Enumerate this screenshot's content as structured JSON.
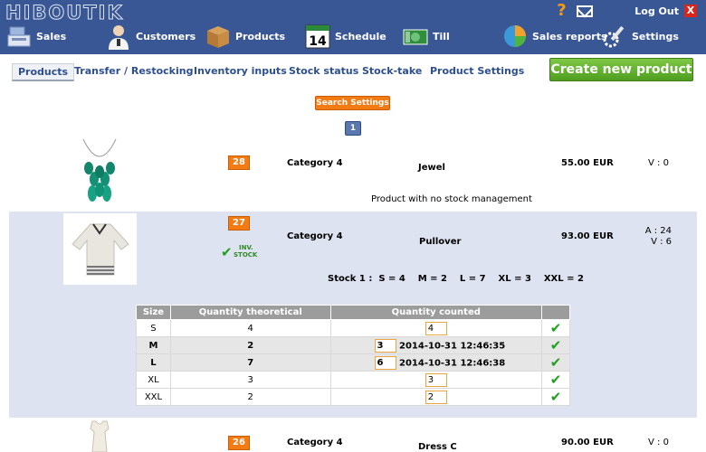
{
  "app": {
    "logo": "HIBOUTIK"
  },
  "header": {
    "nav": [
      {
        "label": "Sales",
        "icon": "register-icon"
      },
      {
        "label": "Customers",
        "icon": "person-icon"
      },
      {
        "label": "Products",
        "icon": "box-icon"
      },
      {
        "label": "Schedule",
        "icon": "calendar-icon",
        "icon_text": "14"
      },
      {
        "label": "Till",
        "icon": "banknote-icon"
      },
      {
        "label": "Sales reports",
        "icon": "pie-chart-icon"
      },
      {
        "label": "Settings",
        "icon": "wrench-gear-icon"
      }
    ],
    "help": "?",
    "logout": "Log Out",
    "close": "X"
  },
  "tabs": [
    {
      "label": "Products",
      "active": true
    },
    {
      "label": "Transfer / Restocking"
    },
    {
      "label": "Inventory inputs"
    },
    {
      "label": "Stock status"
    },
    {
      "label": "Stock-take"
    },
    {
      "label": "Product Settings"
    }
  ],
  "create_button": "Create new product",
  "search_settings": "Search Settings",
  "pagination": {
    "current": "1"
  },
  "products": [
    {
      "id": "28",
      "category": "Category 4",
      "name": "Jewel",
      "price": "55.00 EUR",
      "stock_v": "V : 0",
      "note": "Product with no stock management",
      "image": "necklace"
    },
    {
      "id": "27",
      "category": "Category 4",
      "name": "Pullover",
      "price": "93.00 EUR",
      "stock_a": "A : 24",
      "stock_v": "V : 6",
      "inv_badge": [
        "INV.",
        "STOCK"
      ],
      "stock_line": "Stock 1 :  S = 4    M = 2    L = 7    XL = 3    XXL = 2",
      "table": {
        "headers": [
          "Size",
          "Quantity theoretical",
          "Quantity counted"
        ],
        "rows": [
          {
            "size": "S",
            "theoretical": "4",
            "input": "4",
            "counted_at": ""
          },
          {
            "size": "M",
            "theoretical": "2",
            "input": "3",
            "counted_at": "2014-10-31 12:46:35"
          },
          {
            "size": "L",
            "theoretical": "7",
            "input": "6",
            "counted_at": "2014-10-31 12:46:38"
          },
          {
            "size": "XL",
            "theoretical": "3",
            "input": "3",
            "counted_at": ""
          },
          {
            "size": "XXL",
            "theoretical": "2",
            "input": "2",
            "counted_at": ""
          }
        ]
      },
      "image": "pullover"
    },
    {
      "id": "26",
      "category": "Category 4",
      "name": "Dress C",
      "price": "90.00 EUR",
      "stock_v": "V : 0",
      "image": "dress"
    }
  ],
  "colors": {
    "header_bg": "#3a5795",
    "accent_orange": "#f37b14",
    "accent_green": "#5aad27",
    "highlight_row": "#dde3f0"
  }
}
